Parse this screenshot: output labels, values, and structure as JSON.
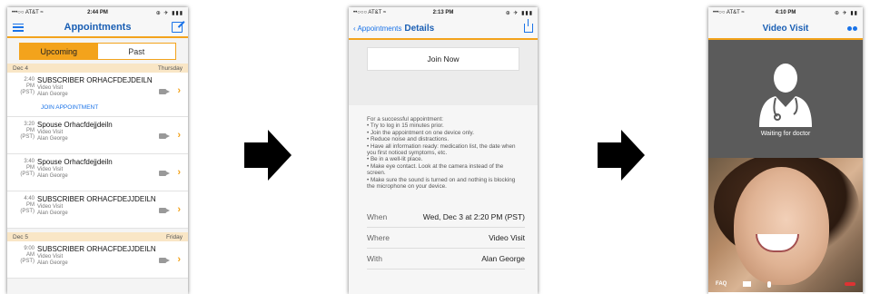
{
  "screens": {
    "list": {
      "status": {
        "carrier": "•••○○ AT&T ≈",
        "time": "2:44 PM",
        "battery": "⊕ ✈ ▮▮▮"
      },
      "title": "Appointments",
      "tabs": {
        "upcoming": "Upcoming",
        "past": "Past"
      },
      "days": [
        {
          "label": "Dec 4",
          "weekday": "Thursday",
          "appointments": [
            {
              "time": "2:40",
              "ampm": "PM",
              "tz": "(PST)",
              "name": "SUBSCRIBER ORHACFDEJDEILN",
              "type": "Video Visit",
              "doctor": "Alan George",
              "action": "JOIN APPOINTMENT"
            },
            {
              "time": "3:20",
              "ampm": "PM",
              "tz": "(PST)",
              "name": "Spouse Orhacfdejjdeiln",
              "type": "Video Visit",
              "doctor": "Alan George"
            },
            {
              "time": "3:40",
              "ampm": "PM",
              "tz": "(PST)",
              "name": "Spouse Orhacfdejjdeiln",
              "type": "Video Visit",
              "doctor": "Alan George"
            },
            {
              "time": "4:40",
              "ampm": "PM",
              "tz": "(PST)",
              "name": "SUBSCRIBER ORHACFDEJJDEILN",
              "type": "Video Visit",
              "doctor": "Alan George"
            }
          ]
        },
        {
          "label": "Dec 5",
          "weekday": "Friday",
          "appointments": [
            {
              "time": "9:00",
              "ampm": "AM",
              "tz": "(PST)",
              "name": "SUBSCRIBER ORHACFDEJJDEILN",
              "type": "Video Visit",
              "doctor": "Alan George"
            }
          ]
        }
      ]
    },
    "details": {
      "status": {
        "carrier": "••○○○ AT&T ≈",
        "time": "2:13 PM",
        "battery": "⊕ ✈ ▮▮▮"
      },
      "back_label": "Appointments",
      "title": "Details",
      "join_label": "Join Now",
      "tips_intro": "For a successful appointment:",
      "tips": [
        "•    Try to log in 15 minutes prior.",
        "•    Join the appointment on one device only.",
        "•    Reduce noise and distractions.",
        "•    Have all information ready: medication list, the date when you first noticed symptoms, etc.",
        "•    Be in a well-lit place.",
        "•    Make eye contact. Look at the camera instead of the screen.",
        "•    Make sure the sound is turned on and nothing is blocking the microphone on your device."
      ],
      "fields": [
        {
          "key": "When",
          "value": "Wed, Dec 3 at 2:20 PM (PST)"
        },
        {
          "key": "Where",
          "value": "Video Visit"
        },
        {
          "key": "With",
          "value": "Alan George"
        }
      ]
    },
    "video": {
      "status": {
        "carrier": "•••○○ AT&T ≈",
        "time": "4:10 PM",
        "battery": "⊕ ✈ ▮▮"
      },
      "title": "Video Visit",
      "waiting_text": "Waiting for doctor",
      "faq_label": "FAQ"
    }
  },
  "colors": {
    "accent": "#f3a31c",
    "link": "#1a73e8",
    "title": "#1a5fb4",
    "day_header": "#f9e6c6"
  }
}
